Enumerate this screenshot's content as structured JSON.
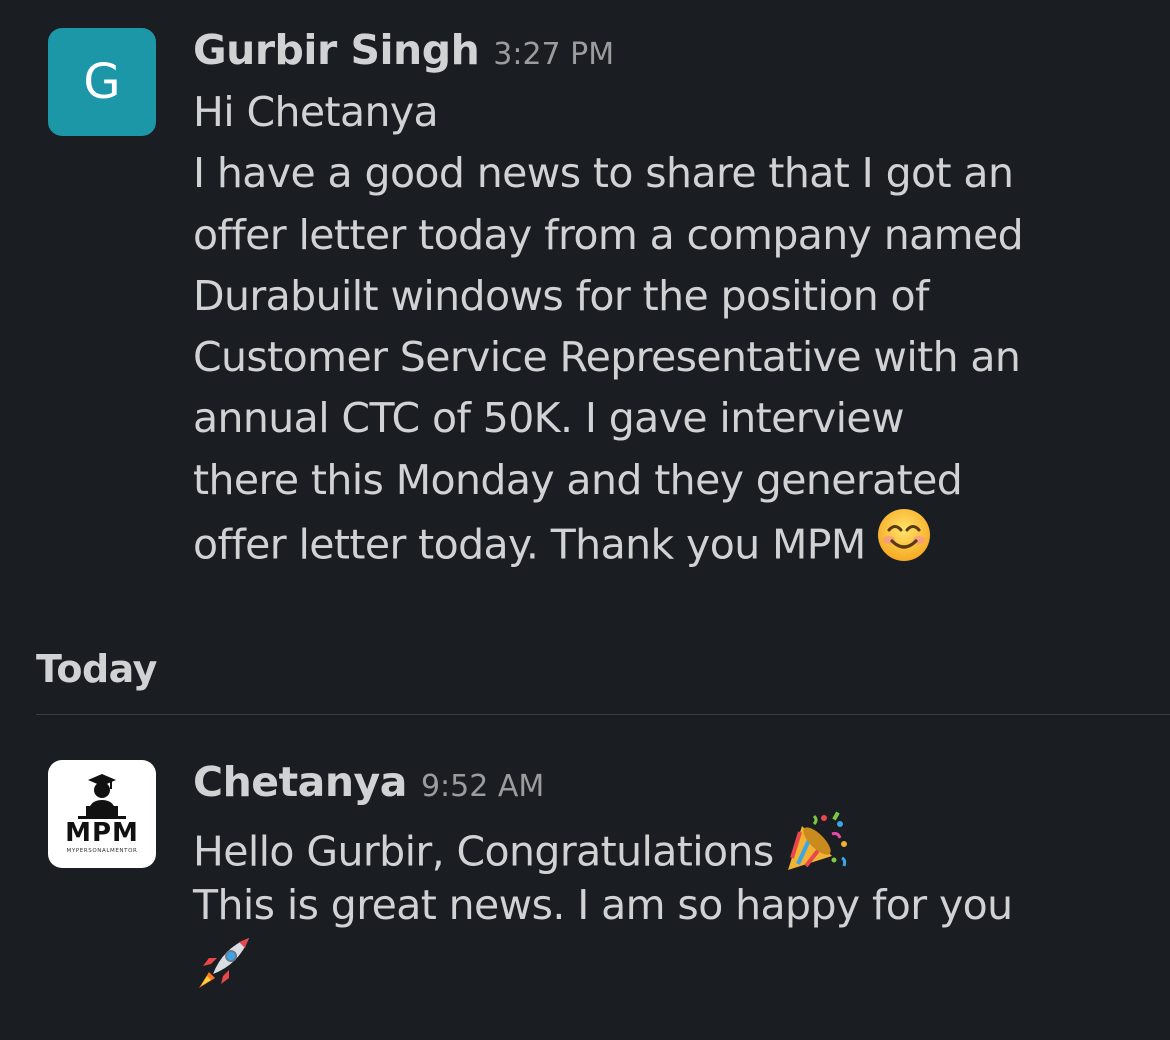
{
  "message_1": {
    "avatar_letter": "G",
    "avatar_color": "#1c97a8",
    "sender": "Gurbir Singh",
    "time": "3:27 PM",
    "lines": [
      "Hi Chetanya",
      "I have a good news to share that I got an",
      "offer letter today from a company named",
      "Durabuilt windows for the position of",
      "Customer Service Representative with an",
      "annual CTC of 50K. I gave interview",
      "there this Monday and they generated",
      "offer letter today. Thank you MPM"
    ],
    "trailing_emoji": "smiling-face-icon"
  },
  "day_divider": {
    "label": "Today"
  },
  "message_2": {
    "avatar_logo_text": "MPM",
    "avatar_logo_subtext": "MYPERSONALMENTOR",
    "sender": "Chetanya",
    "time": "9:52 AM",
    "lines": [
      "Hello Gurbir, Congratulations",
      "This is great news. I am so happy for you"
    ],
    "emojis": [
      "party-popper-icon",
      "rocket-icon"
    ]
  },
  "colors": {
    "background": "#1a1d21",
    "text": "#d1d2d3",
    "timestamp": "#9b9c9e"
  }
}
